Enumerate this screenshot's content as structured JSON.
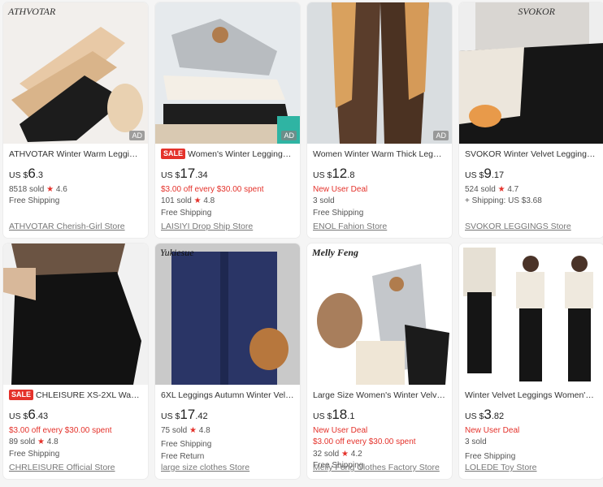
{
  "products": [
    {
      "brand_mark": "ATHVOTAR",
      "ad": "AD",
      "title": "ATHVOTAR Winter Warm Leggings...",
      "sale": "",
      "currency": "US $",
      "price_int": "6",
      "price_dec": ".3",
      "promo": "",
      "promo2": "",
      "sold": "8518 sold",
      "rating": "4.6",
      "shipping": "Free Shipping",
      "shipping2": "",
      "store": "ATHVOTAR Cherish-Girl Store"
    },
    {
      "brand_mark": "",
      "ad": "AD",
      "title": "Women's Winter Leggings ...",
      "sale": "SALE",
      "currency": "US $",
      "price_int": "17",
      "price_dec": ".34",
      "promo": "$3.00 off every $30.00 spent",
      "promo2": "",
      "sold": "101 sold",
      "rating": "4.8",
      "shipping": "Free Shipping",
      "shipping2": "",
      "store": "LAISIYI Drop Ship Store"
    },
    {
      "brand_mark": "",
      "ad": "AD",
      "title": "Women Winter Warm Thick Leggin...",
      "sale": "",
      "currency": "US $",
      "price_int": "12",
      "price_dec": ".8",
      "promo": "New User Deal",
      "promo2": "",
      "sold": "3 sold",
      "rating": "",
      "shipping": "Free Shipping",
      "shipping2": "",
      "store": "ENOL Fahion Store"
    },
    {
      "brand_mark": "SVOKOR",
      "ad": "",
      "title": "SVOKOR Winter Velvet Leggings W...",
      "sale": "",
      "currency": "US $",
      "price_int": "9",
      "price_dec": ".17",
      "promo": "",
      "promo2": "",
      "sold": "524 sold",
      "rating": "4.7",
      "shipping": "+ Shipping: US $3.68",
      "shipping2": "",
      "store": "SVOKOR LEGGINGS Store"
    },
    {
      "brand_mark": "",
      "ad": "",
      "title": "CHLEISURE XS-2XL Warm L...",
      "sale": "SALE",
      "currency": "US $",
      "price_int": "6",
      "price_dec": ".43",
      "promo": "$3.00 off every $30.00 spent",
      "promo2": "",
      "sold": "89 sold",
      "rating": "4.8",
      "shipping": "Free Shipping",
      "shipping2": "",
      "store": "CHRLEISURE Official Store"
    },
    {
      "brand_mark": "Yukiesue",
      "ad": "",
      "title": "6XL Leggings Autumn Winter Velve...",
      "sale": "",
      "currency": "US $",
      "price_int": "17",
      "price_dec": ".42",
      "promo": "",
      "promo2": "",
      "sold": "75 sold",
      "rating": "4.8",
      "shipping": "Free Shipping",
      "shipping2": "Free Return",
      "store": "large size clothes Store"
    },
    {
      "brand_mark": "Melly Feng",
      "ad": "",
      "title": "Large Size Women's Winter Velvet ...",
      "sale": "",
      "currency": "US $",
      "price_int": "18",
      "price_dec": ".1",
      "promo": "New User Deal",
      "promo2": "$3.00 off every $30.00 spent",
      "sold": "32 sold",
      "rating": "4.2",
      "shipping": "Free Shipping",
      "shipping2": "",
      "store": "Melly Feng Clothes Factory Store"
    },
    {
      "brand_mark": "",
      "ad": "",
      "title": "Winter Velvet Leggings Women's ...",
      "sale": "",
      "currency": "US $",
      "price_int": "3",
      "price_dec": ".82",
      "promo": "New User Deal",
      "promo2": "",
      "sold": "3 sold",
      "rating": "",
      "shipping": "Free Shipping",
      "shipping2": "",
      "store": "LOLEDE Toy Store"
    }
  ],
  "colors": {
    "accent": "#e4322b",
    "background": "#f5f5f5"
  },
  "icons": {
    "rating": "star-icon"
  }
}
